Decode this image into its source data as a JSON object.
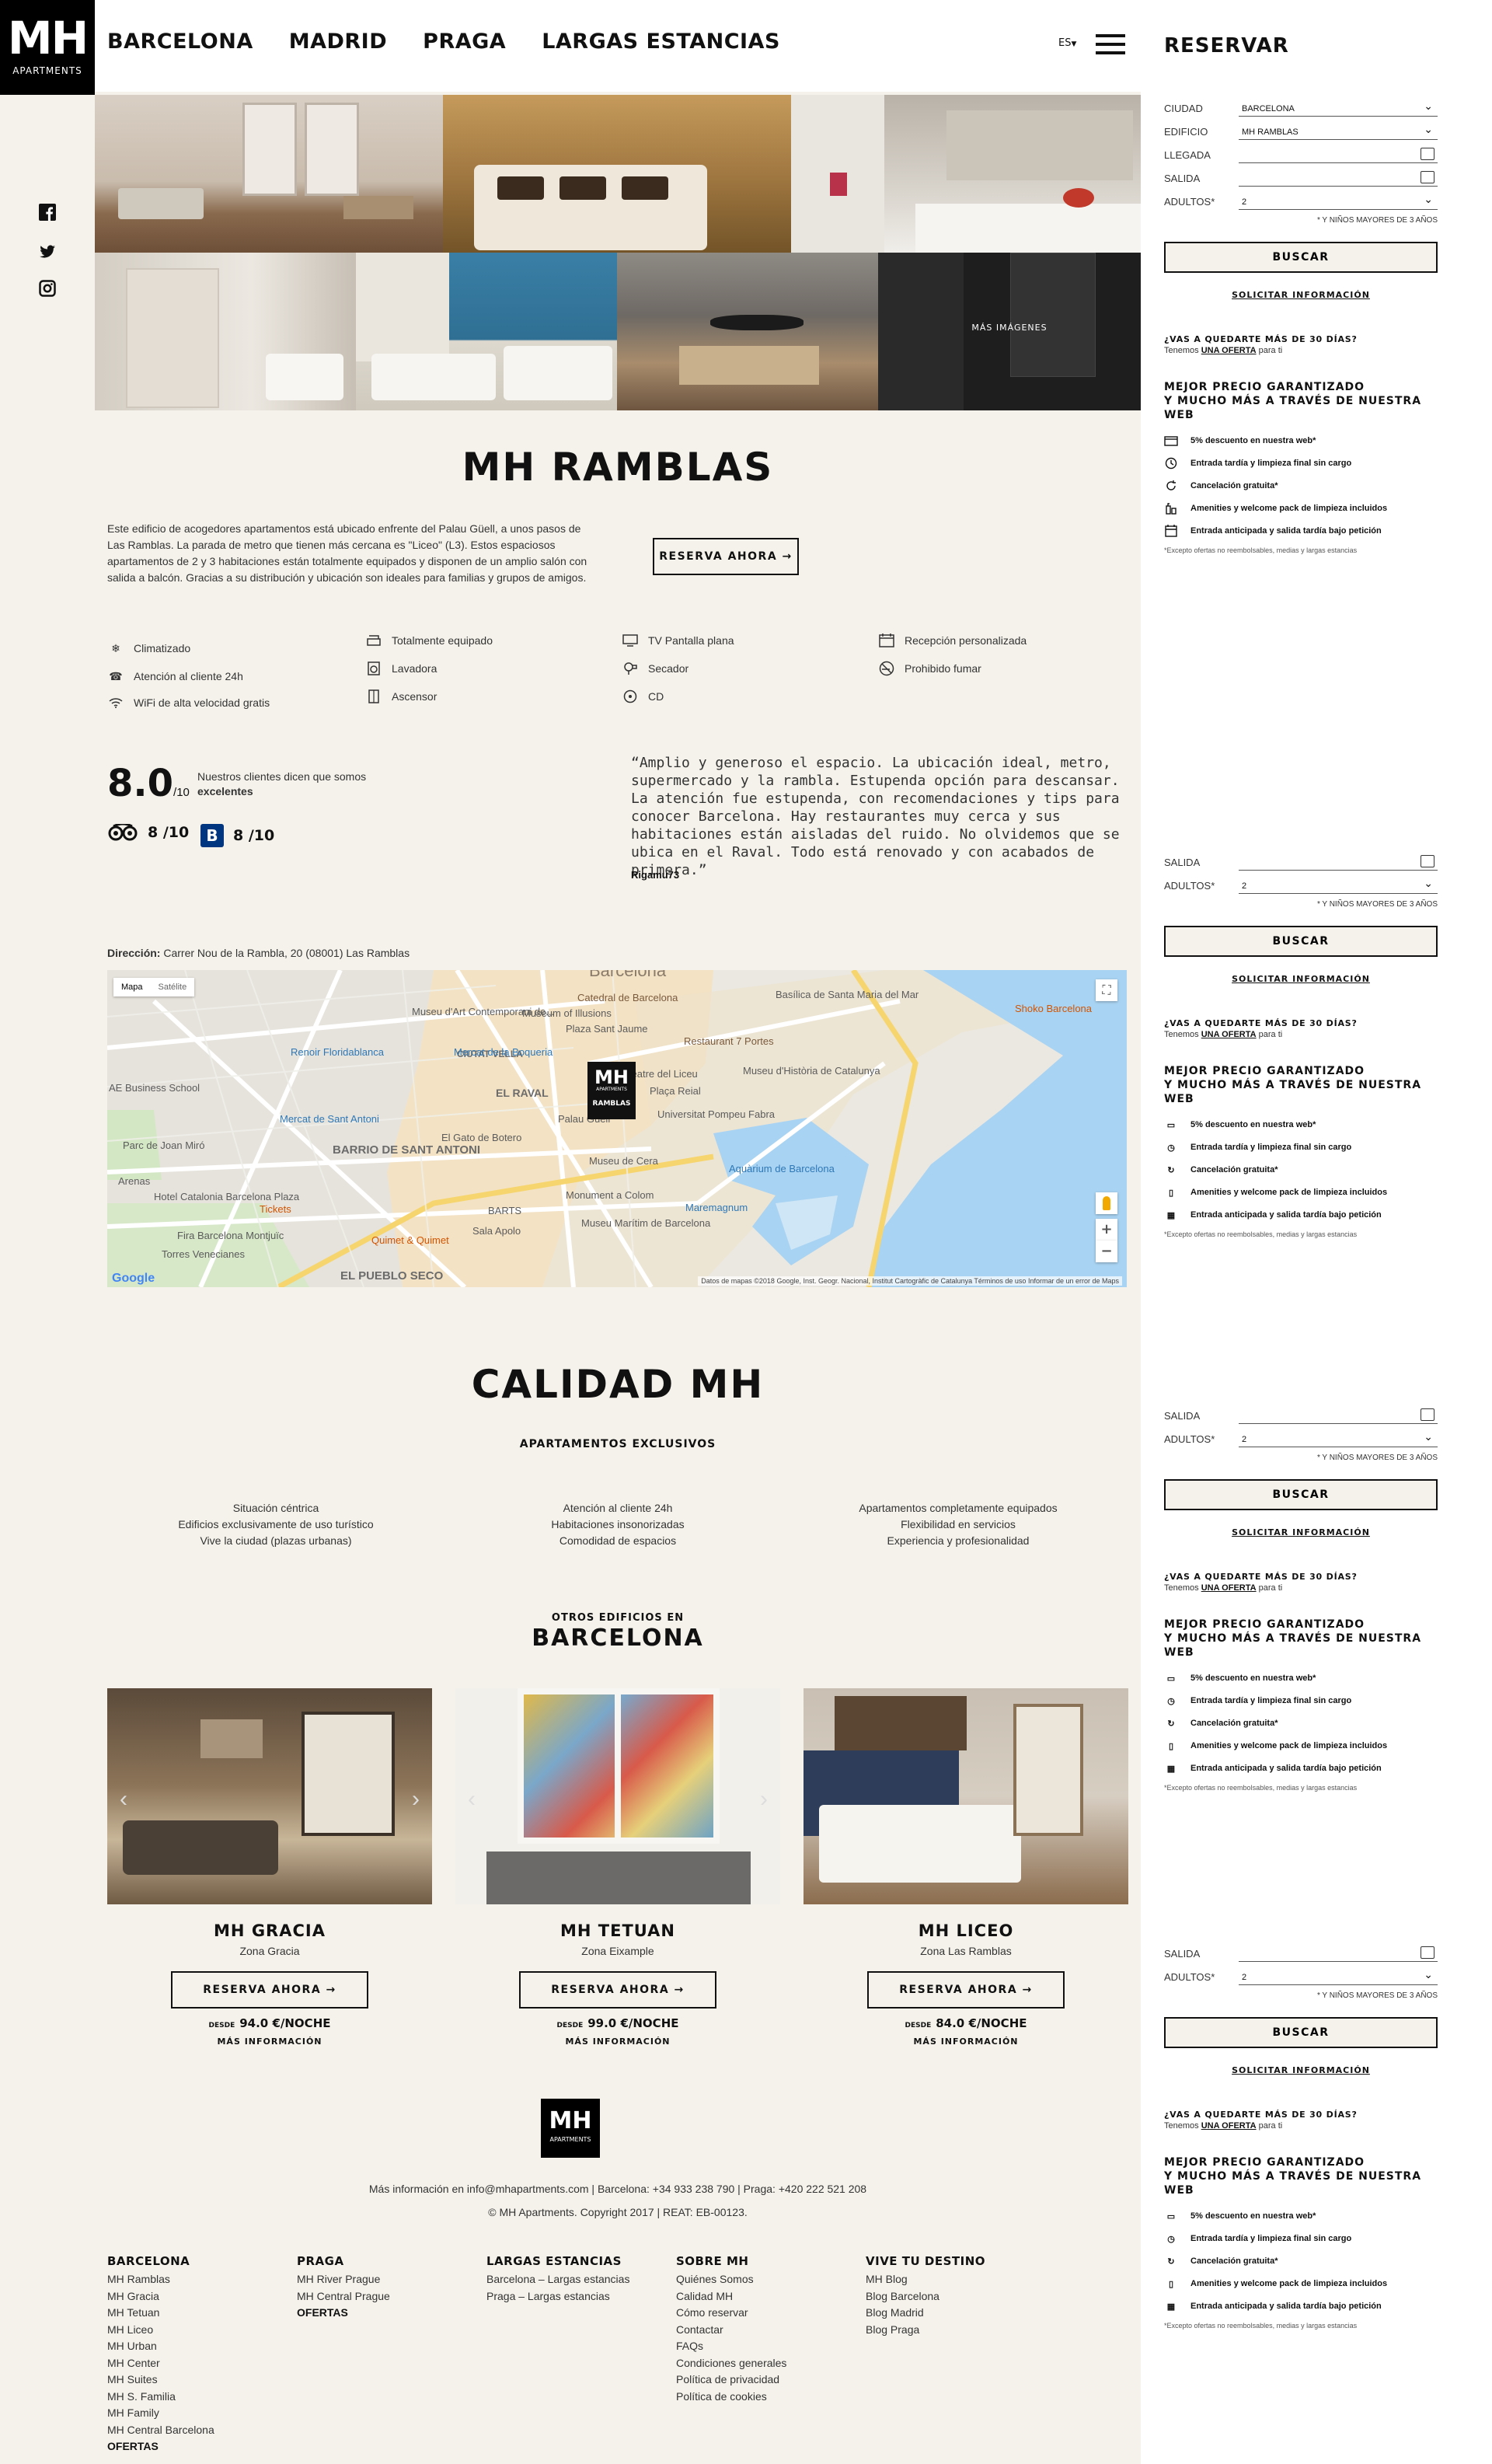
{
  "header": {
    "logo_text": "MH",
    "logo_sub": "APARTMENTS",
    "nav": [
      "BARCELONA",
      "MADRID",
      "PRAGA",
      "LARGAS ESTANCIAS"
    ],
    "lang": "ES",
    "icons": {
      "menu": "hamburger-icon"
    }
  },
  "social": [
    "facebook-icon",
    "twitter-icon",
    "instagram-icon"
  ],
  "gallery": {
    "more_images": "MÁS IMÁGENES"
  },
  "sidebar": {
    "title": "RESERVAR",
    "fields": {
      "ciudad_label": "CIUDAD",
      "ciudad_value": "BARCELONA",
      "edificio_label": "EDIFICIO",
      "edificio_value": "MH RAMBLAS",
      "llegada_label": "LLEGADA",
      "salida_label": "SALIDA",
      "adultos_label": "ADULTOS*",
      "adultos_value": "2",
      "note": "* Y NIÑOS MAYORES DE 3 AÑOS"
    },
    "buscar": "BUSCAR",
    "solicitar": "SOLICITAR INFORMACIÓN",
    "q30_title": "¿VAS A QUEDARTE MÁS DE 30 DÍAS?",
    "q30_pre": "Tenemos",
    "q30_link": "UNA OFERTA",
    "q30_post": "para ti",
    "mejor_1": "MEJOR PRECIO GARANTIZADO",
    "mejor_2": "Y MUCHO MÁS A TRAVÉS DE NUESTRA WEB",
    "perks": [
      "5% descuento en nuestra web*",
      "Entrada tardía y limpieza final sin cargo",
      "Cancelación gratuita*",
      "Amenities y welcome pack de limpieza incluidos",
      "Entrada anticipada y salida tardía bajo petición"
    ],
    "disclaimer": "*Excepto ofertas no reembolsables, medias y largas estancias"
  },
  "main": {
    "title": "MH RAMBLAS",
    "description": "Este edificio de acogedores apartamentos está ubicado enfrente del Palau Güell, a unos pasos de Las Ramblas. La parada de metro que tienen más cercana es \"Liceo\" (L3). Estos espaciosos apartamentos de 2 y 3 habitaciones están totalmente equipados y disponen de un amplio salón con salida a balcón. Gracias a su distribución y ubicación son ideales para familias y grupos de amigos.",
    "reserva": "RESERVA AHORA →",
    "amenities": [
      "Climatizado",
      "Atención al cliente 24h",
      "WiFi de alta velocidad gratis",
      "Totalmente equipado",
      "Lavadora",
      "Ascensor",
      "TV Pantalla plana",
      "Secador",
      "CD",
      "Recepción personalizada",
      "Prohibido fumar"
    ],
    "score": "8.0",
    "score_of": "/10",
    "score_text": "Nuestros clientes dicen que somos",
    "score_bold": "excelentes",
    "tripadvisor": "8 /10",
    "booking": "8 /10",
    "review": "“Amplio y generoso el espacio. La ubicación ideal, metro, supermercado y la rambla. Estupenda opción para descansar. La atención fue estupenda, con recomendaciones y tips para conocer Barcelona. Hay restaurantes muy cerca y sus habitaciones están aisladas del ruido. No olvidemos que se ubica en el Raval. Todo está renovado y con acabados de primera.”",
    "reviewer": "Rigamu73",
    "dir_label": "Dirección:",
    "dir_value": "Carrer Nou de la Rambla, 20 (08001) Las Ramblas"
  },
  "map": {
    "tab_map": "Mapa",
    "tab_sat": "Satélite",
    "labels": [
      "Barcelona",
      "EL RAVAL",
      "BARRIO DE SANT ANTONI",
      "CIUTAT VELLA",
      "EL PUEBLO SECO",
      "Catedral de Barcelona",
      "Museum of Illusions",
      "Plaza Sant Jaume",
      "Mercat de la Boqueria",
      "Museu d'Art Contemporani de...",
      "Renoir Floridablanca",
      "Mercat de Sant Antoni",
      "El Gato de Botero",
      "Museu de Cera",
      "Aquàrium de Barcelona",
      "Monument a Colom",
      "Museu Marítim de Barcelona",
      "Maremagnum",
      "Universitat Pompeu Fabra",
      "Teatre del Liceu",
      "Plaça Reial",
      "Museu d'Història de Catalunya",
      "Basílica de Santa Maria del Mar",
      "Hotel Catalonia Barcelona Plaza",
      "Fira Barcelona Montjuïc",
      "Torres Venecianes",
      "Restaurant 7 Portes",
      "Shoko Barcelona",
      "Arenas",
      "AE Business School",
      "Parc de Joan Miró",
      "Quimet & Quimet",
      "Sala Apolo",
      "BARTS",
      "Tickets",
      "Palau Güell"
    ],
    "pin_top": "MH",
    "pin_sub": "APARTMENTS",
    "pin_name": "RAMBLAS",
    "google": "Google",
    "footer": "Datos de mapas ©2018 Google, Inst. Geogr. Nacional, Institut Cartogràfic de Catalunya   Términos de uso   Informar de un error de Maps"
  },
  "calidad": {
    "title": "CALIDAD MH",
    "sub": "APARTAMENTOS EXCLUSIVOS",
    "col1": [
      "Situación céntrica",
      "Edificios exclusivamente de uso turístico",
      "Vive la ciudad (plazas urbanas)"
    ],
    "col2": [
      "Atención al cliente 24h",
      "Habitaciones insonorizadas",
      "Comodidad de espacios"
    ],
    "col3": [
      "Apartamentos completamente equipados",
      "Flexibilidad en servicios",
      "Experiencia y profesionalidad"
    ]
  },
  "otros": {
    "pre": "OTROS EDIFICIOS EN",
    "city": "BARCELONA",
    "cards": [
      {
        "name": "MH GRACIA",
        "zone": "Zona Gracia",
        "btn": "RESERVA AHORA →",
        "desde": "DESDE",
        "price": "94.0 €/NOCHE",
        "more": "MÁS INFORMACIÓN"
      },
      {
        "name": "MH TETUAN",
        "zone": "Zona Eixample",
        "btn": "RESERVA AHORA →",
        "desde": "DESDE",
        "price": "99.0 €/NOCHE",
        "more": "MÁS INFORMACIÓN"
      },
      {
        "name": "MH LICEO",
        "zone": "Zona Las Ramblas",
        "btn": "RESERVA AHORA →",
        "desde": "DESDE",
        "price": "84.0 €/NOCHE",
        "more": "MÁS INFORMACIÓN"
      }
    ]
  },
  "footer": {
    "logo_text": "MH",
    "logo_sub": "APARTMENTS",
    "info": "Más información en info@mhapartments.com | Barcelona: +34 933 238 790 | Praga: +420 222 521 208",
    "copy": "© MH Apartments. Copyright 2017 | REAT: EB-00123.",
    "cols": [
      {
        "title": "BARCELONA",
        "items": [
          "MH Ramblas",
          "MH Gracia",
          "MH Tetuan",
          "MH Liceo",
          "MH Urban",
          "MH Center",
          "MH Suites",
          "MH S. Familia",
          "MH Family",
          "MH Central Barcelona"
        ],
        "bold": "OFERTAS"
      },
      {
        "title": "PRAGA",
        "items": [
          "MH River Prague",
          "MH Central Prague"
        ],
        "bold": "OFERTAS"
      },
      {
        "title": "LARGAS ESTANCIAS",
        "items": [
          "Barcelona – Largas estancias",
          "Praga – Largas estancias"
        ],
        "bold": ""
      },
      {
        "title": "SOBRE MH",
        "items": [
          "Quiénes Somos",
          "Calidad MH",
          "Cómo reservar",
          "Contactar",
          "FAQs",
          "Condiciones generales",
          "Política de privacidad",
          "Política de cookies"
        ],
        "bold": ""
      },
      {
        "title": "VIVE TU DESTINO",
        "items": [
          "MH Blog",
          "Blog Barcelona",
          "Blog Madrid",
          "Blog Praga"
        ],
        "bold": ""
      }
    ]
  },
  "colors": {
    "background": "#f4f2ea",
    "accent": "#111111",
    "sidebar": "#ffffff"
  }
}
